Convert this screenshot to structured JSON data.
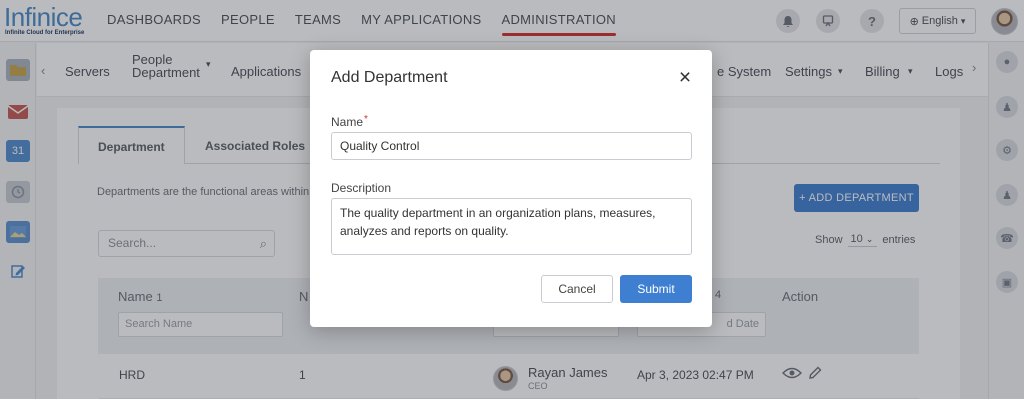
{
  "brand": {
    "logo_text": "Infinice",
    "tagline": "Infinite Cloud for Enterprise"
  },
  "top_nav": [
    {
      "label": "DASHBOARDS",
      "active": false
    },
    {
      "label": "PEOPLE",
      "active": false
    },
    {
      "label": "TEAMS",
      "active": false
    },
    {
      "label": "MY APPLICATIONS",
      "active": false
    },
    {
      "label": "ADMINISTRATION",
      "active": true
    }
  ],
  "header_icons": [
    "bell-icon",
    "support-icon",
    "help-icon"
  ],
  "language": {
    "label": "English",
    "icon": "globe-icon"
  },
  "sub_nav": {
    "left_items": [
      "Servers",
      "People",
      "Department",
      "Applications"
    ],
    "right_items": [
      "e System",
      "Settings",
      "Billing",
      "Logs"
    ]
  },
  "left_rail_icons": [
    "folder-icon",
    "mail-icon",
    "calendar-icon",
    "timer-icon",
    "image-icon",
    "edit-icon"
  ],
  "calendar_day": "31",
  "right_rail_icons": [
    "chat-icon",
    "user-icon",
    "user-settings-icon",
    "group-icon",
    "phone-icon",
    "calendar-check-icon"
  ],
  "page": {
    "tabs": [
      "Department",
      "Associated Roles"
    ],
    "description": "Departments are the functional areas within",
    "add_button": "+ ADD DEPARTMENT",
    "search_placeholder": "Search...",
    "show_label": "Show",
    "show_value": "10",
    "entries_label": "entries",
    "columns": {
      "name": "Name",
      "name_sort": "1",
      "number": "N",
      "date_sort": "4",
      "action": "Action"
    },
    "filters": {
      "name_placeholder": "Search Name",
      "date_placeholder": "d Date"
    },
    "rows": [
      {
        "name": "HRD",
        "number": "1",
        "person_name": "Rayan James",
        "person_role": "CEO",
        "date": "Apr 3, 2023 02:47 PM"
      }
    ]
  },
  "modal": {
    "title": "Add Department",
    "name_label": "Name",
    "required_mark": "*",
    "name_value": "Quality Control",
    "description_label": "Description",
    "description_value": "The quality department in an organization plans, measures, analyzes and reports on quality.",
    "cancel_label": "Cancel",
    "submit_label": "Submit"
  }
}
